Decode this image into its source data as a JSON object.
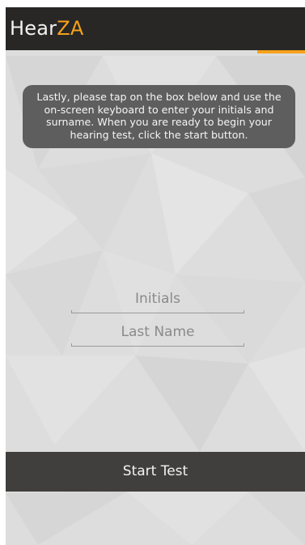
{
  "app_bar": {
    "title_part1": "Hear",
    "title_part2": "ZA"
  },
  "instructions": {
    "text": "Lastly, please tap on the box below and  use the on-screen keyboard to enter your initials and surname. When you are ready to begin your hearing test, click the start button."
  },
  "form": {
    "initials_placeholder": "Initials",
    "lastname_placeholder": "Last Name"
  },
  "actions": {
    "start_label": "Start Test"
  },
  "colors": {
    "app_bar": "#282726",
    "accent": "#f6a21b",
    "background": "#dcdcdc",
    "instruction_box": "#5e5e5e",
    "start_button": "#403f3e"
  }
}
